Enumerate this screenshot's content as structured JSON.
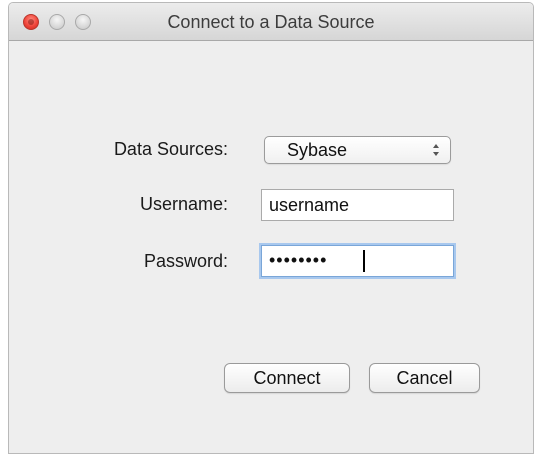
{
  "window": {
    "title": "Connect to a Data Source"
  },
  "form": {
    "data_sources_label": "Data Sources:",
    "data_sources_value": "Sybase",
    "username_label": "Username:",
    "username_value": "username",
    "password_label": "Password:",
    "password_masked": "••••••••"
  },
  "buttons": {
    "connect_label": "Connect",
    "cancel_label": "Cancel"
  },
  "icons": {
    "close": "close-icon",
    "minimize": "minimize-icon",
    "maximize": "maximize-icon",
    "select_arrows": "chevron-up-down-icon"
  },
  "colors": {
    "close_button": "#f0463b",
    "focus_ring": "#a8c8ee",
    "window_background": "#eeeeee"
  }
}
